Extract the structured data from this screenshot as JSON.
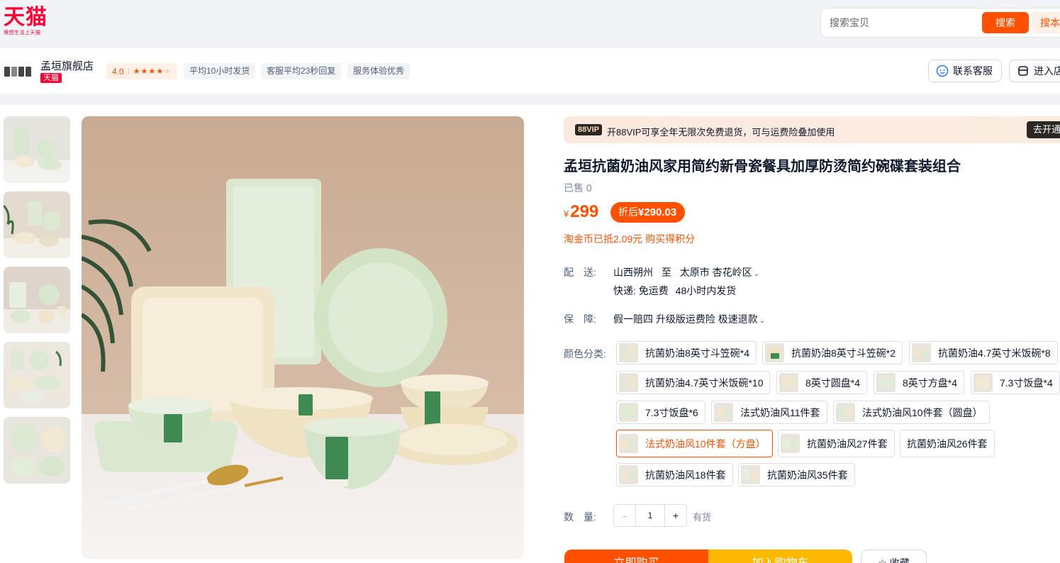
{
  "header": {
    "logo_text": "天猫",
    "logo_slogan": "理想生活上天猫",
    "search_placeholder": "搜索宝贝",
    "search_button": "搜索",
    "search_store_button": "搜本店"
  },
  "shop": {
    "name": "孟垣旗舰店",
    "badge": "天猫",
    "rating": "4.0",
    "rating_stars": 4,
    "tags": [
      "平均10小时发货",
      "客服平均23秒回复",
      "服务体验优秀"
    ],
    "contact_button": "联系客服",
    "enter_store_button": "进入店铺"
  },
  "gallery": {
    "thumbnails": [
      "thumb-1",
      "thumb-2",
      "thumb-3",
      "thumb-4",
      "thumb-5"
    ],
    "main_image_alt": "抗菌奶油风餐具套装"
  },
  "vip": {
    "badge": "88VIP",
    "text": "开88VIP可享全年无限次免费退货，可与运费险叠加使用",
    "button": "去开通"
  },
  "product": {
    "title": "孟垣抗菌奶油风家用简约新骨瓷餐具加厚防烫简约碗碟套装组合",
    "sold": "已售 0",
    "price_currency": "¥",
    "price": "299",
    "discount_label": "折后",
    "discount_currency": "¥",
    "discount_price": "290.03",
    "coin_note": "淘金币已抵2.09元 购买得积分"
  },
  "shipping": {
    "label": "配　送:",
    "from": "山西朔州",
    "to_word": "至",
    "destination": "太原市 杏花岭区",
    "method": "快递: 免运费",
    "eta": "48小时内发货"
  },
  "guarantee": {
    "label": "保　障:",
    "text": "假一赔四 升级版运费险 极速退款"
  },
  "sku": {
    "label": "颜色分类:",
    "options": [
      {
        "label": "抗菌奶油8英寸斗笠碗*4",
        "selected": false
      },
      {
        "label": "抗菌奶油8英寸斗笠碗*2",
        "selected": false
      },
      {
        "label": "抗菌奶油4.7英寸米饭碗*8",
        "selected": false
      },
      {
        "label": "抗菌奶油4.7英寸米饭碗*10",
        "selected": false
      },
      {
        "label": "8英寸圆盘*4",
        "selected": false
      },
      {
        "label": "8英寸方盘*4",
        "selected": false
      },
      {
        "label": "7.3寸饭盘*4",
        "selected": false
      },
      {
        "label": "7.3寸饭盘*6",
        "selected": false
      },
      {
        "label": "法式奶油风11件套",
        "selected": false
      },
      {
        "label": "法式奶油风10件套（圆盘）",
        "selected": false
      },
      {
        "label": "法式奶油风10件套（方盘）",
        "selected": true
      },
      {
        "label": "抗菌奶油风27件套",
        "selected": false
      },
      {
        "label": "抗菌奶油风26件套",
        "selected": false
      },
      {
        "label": "抗菌奶油风18件套",
        "selected": false
      },
      {
        "label": "抗菌奶油风35件套",
        "selected": false
      }
    ]
  },
  "quantity": {
    "label": "数　量:",
    "minus": "-",
    "value": "1",
    "plus": "+",
    "stock": "有货"
  },
  "actions": {
    "buy": "立即购买",
    "cart": "加入购物车",
    "favorite": "收藏"
  },
  "colors": {
    "accent": "#ff5000",
    "tmall_red": "#ff0036",
    "cart_yellow": "#ffb800"
  }
}
